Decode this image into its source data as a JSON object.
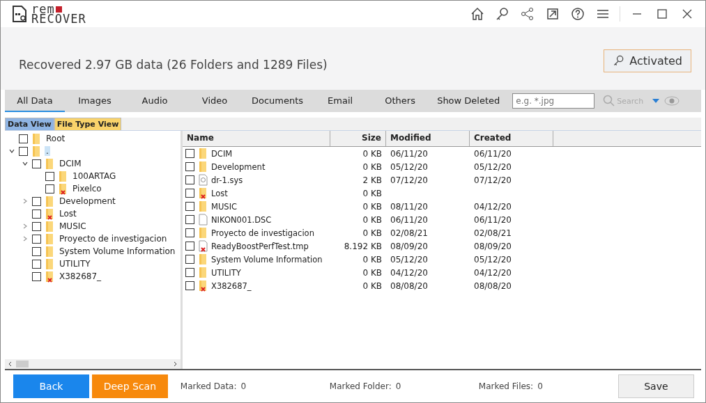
{
  "logo": {
    "top": "rem",
    "bottom": "RECOVER"
  },
  "summary": "Recovered 2.97 GB data (26 Folders and 1289 Files)",
  "activated_button": "Activated",
  "tabs": [
    {
      "label": "All Data",
      "selected": true
    },
    {
      "label": "Images",
      "selected": false
    },
    {
      "label": "Audio",
      "selected": false
    },
    {
      "label": "Video",
      "selected": false
    },
    {
      "label": "Documents",
      "selected": false
    },
    {
      "label": "Email",
      "selected": false
    },
    {
      "label": "Others",
      "selected": false
    },
    {
      "label": "Show Deleted",
      "selected": false
    }
  ],
  "search": {
    "placeholder": "e.g. *.jpg",
    "button": "Search"
  },
  "view_tabs": [
    {
      "label": "Data View",
      "selected": true
    },
    {
      "label": "File Type View",
      "selected": false
    }
  ],
  "tree": [
    {
      "label": "Root",
      "checked": false,
      "selected": false,
      "deleted": false
    },
    {
      "label": ".",
      "checked": false,
      "selected": true,
      "deleted": false,
      "expanded": true,
      "children": [
        {
          "label": "DCIM",
          "checked": false,
          "selected": false,
          "deleted": false,
          "expanded": true,
          "children": [
            {
              "label": "100ARTAG",
              "checked": false,
              "selected": false,
              "deleted": false
            },
            {
              "label": "Pixelco",
              "checked": false,
              "selected": false,
              "deleted": true
            }
          ]
        },
        {
          "label": "Development",
          "checked": false,
          "selected": false,
          "deleted": false,
          "expanded": false
        },
        {
          "label": "Lost",
          "checked": false,
          "selected": false,
          "deleted": true
        },
        {
          "label": "MUSIC",
          "checked": false,
          "selected": false,
          "deleted": false,
          "expanded": false
        },
        {
          "label": "Proyecto de investigacion",
          "checked": false,
          "selected": false,
          "deleted": false,
          "expanded": false
        },
        {
          "label": "System Volume Information",
          "checked": false,
          "selected": false,
          "deleted": false
        },
        {
          "label": "UTILITY",
          "checked": false,
          "selected": false,
          "deleted": false
        },
        {
          "label": "X382687_",
          "checked": false,
          "selected": false,
          "deleted": true
        }
      ]
    }
  ],
  "table": {
    "columns": [
      "Name",
      "Size",
      "Modified",
      "Created"
    ],
    "rows": [
      {
        "name": "DCIM",
        "kind": "folder",
        "deleted": false,
        "checked": false,
        "size": "0 KB",
        "modified": "06/11/20",
        "created": "06/11/20"
      },
      {
        "name": "Development",
        "kind": "folder",
        "deleted": false,
        "checked": false,
        "size": "0 KB",
        "modified": "05/12/20",
        "created": "05/12/20"
      },
      {
        "name": "dr-1.sys",
        "kind": "system",
        "deleted": false,
        "checked": false,
        "size": "2 KB",
        "modified": "07/12/20",
        "created": "07/12/20"
      },
      {
        "name": "Lost",
        "kind": "folder",
        "deleted": true,
        "checked": false,
        "size": "0 KB"
      },
      {
        "name": "MUSIC",
        "kind": "folder",
        "deleted": false,
        "checked": false,
        "size": "0 KB",
        "modified": "08/11/20",
        "created": "04/12/20"
      },
      {
        "name": "NIKON001.DSC",
        "kind": "file",
        "deleted": false,
        "checked": false,
        "size": "0 KB",
        "modified": "06/11/20",
        "created": "06/11/20"
      },
      {
        "name": "Proyecto de investigacion",
        "kind": "folder",
        "deleted": false,
        "checked": false,
        "size": "0 KB",
        "modified": "02/08/21",
        "created": "02/08/21"
      },
      {
        "name": "ReadyBoostPerfTest.tmp",
        "kind": "file",
        "deleted": true,
        "checked": false,
        "size": "8.192 KB",
        "modified": "08/09/20",
        "created": "08/09/20"
      },
      {
        "name": "System Volume Information",
        "kind": "folder",
        "deleted": false,
        "checked": false,
        "size": "0 KB",
        "modified": "05/12/20",
        "created": "05/12/20"
      },
      {
        "name": "UTILITY",
        "kind": "folder",
        "deleted": false,
        "checked": false,
        "size": "0 KB",
        "modified": "04/12/20",
        "created": "04/12/20"
      },
      {
        "name": "X382687_",
        "kind": "folder",
        "deleted": true,
        "checked": false,
        "size": "0 KB",
        "modified": "08/08/20",
        "created": "08/08/20"
      }
    ]
  },
  "footer": {
    "back": "Back",
    "deep_scan": "Deep Scan",
    "stats": [
      {
        "label": "Marked Data:",
        "value": "0"
      },
      {
        "label": "Marked Folder:",
        "value": "0"
      },
      {
        "label": "Marked Files:",
        "value": "0"
      }
    ],
    "save": "Save"
  }
}
